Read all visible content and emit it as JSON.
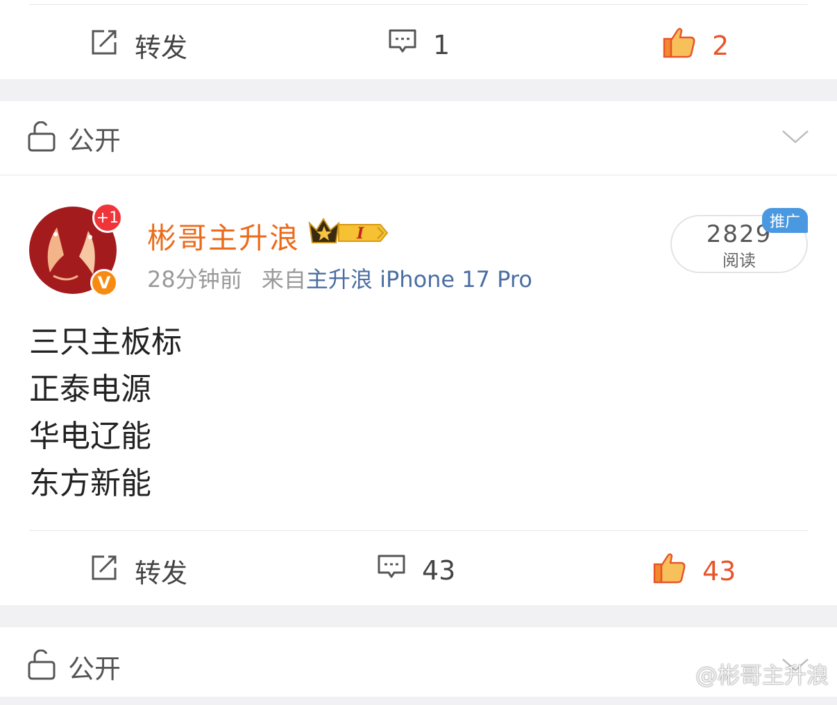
{
  "prev_post": {
    "repost_label": "转发",
    "comment_count": "1",
    "like_count": "2"
  },
  "privacy_label": "公开",
  "post": {
    "avatar_badge": "+1",
    "verified_badge": "V",
    "username": "彬哥主升浪",
    "vip_level": "I",
    "time": "28分钟前",
    "from_label": "来自",
    "source": "主升浪 iPhone 17 Pro",
    "reads_count": "2829",
    "reads_label": "阅读",
    "promo_badge": "推广",
    "content_lines": [
      "三只主板标",
      "正泰电源",
      "华电辽能",
      "东方新能"
    ],
    "repost_label": "转发",
    "comment_count": "43",
    "like_count": "43"
  },
  "next_post": {
    "privacy_label": "公开"
  },
  "watermark": "@彬哥主升浪",
  "colors": {
    "accent_orange": "#ec6b1b",
    "like_red": "#e8542a",
    "source_blue": "#4a6ea3",
    "promo_blue": "#4a98e0"
  }
}
